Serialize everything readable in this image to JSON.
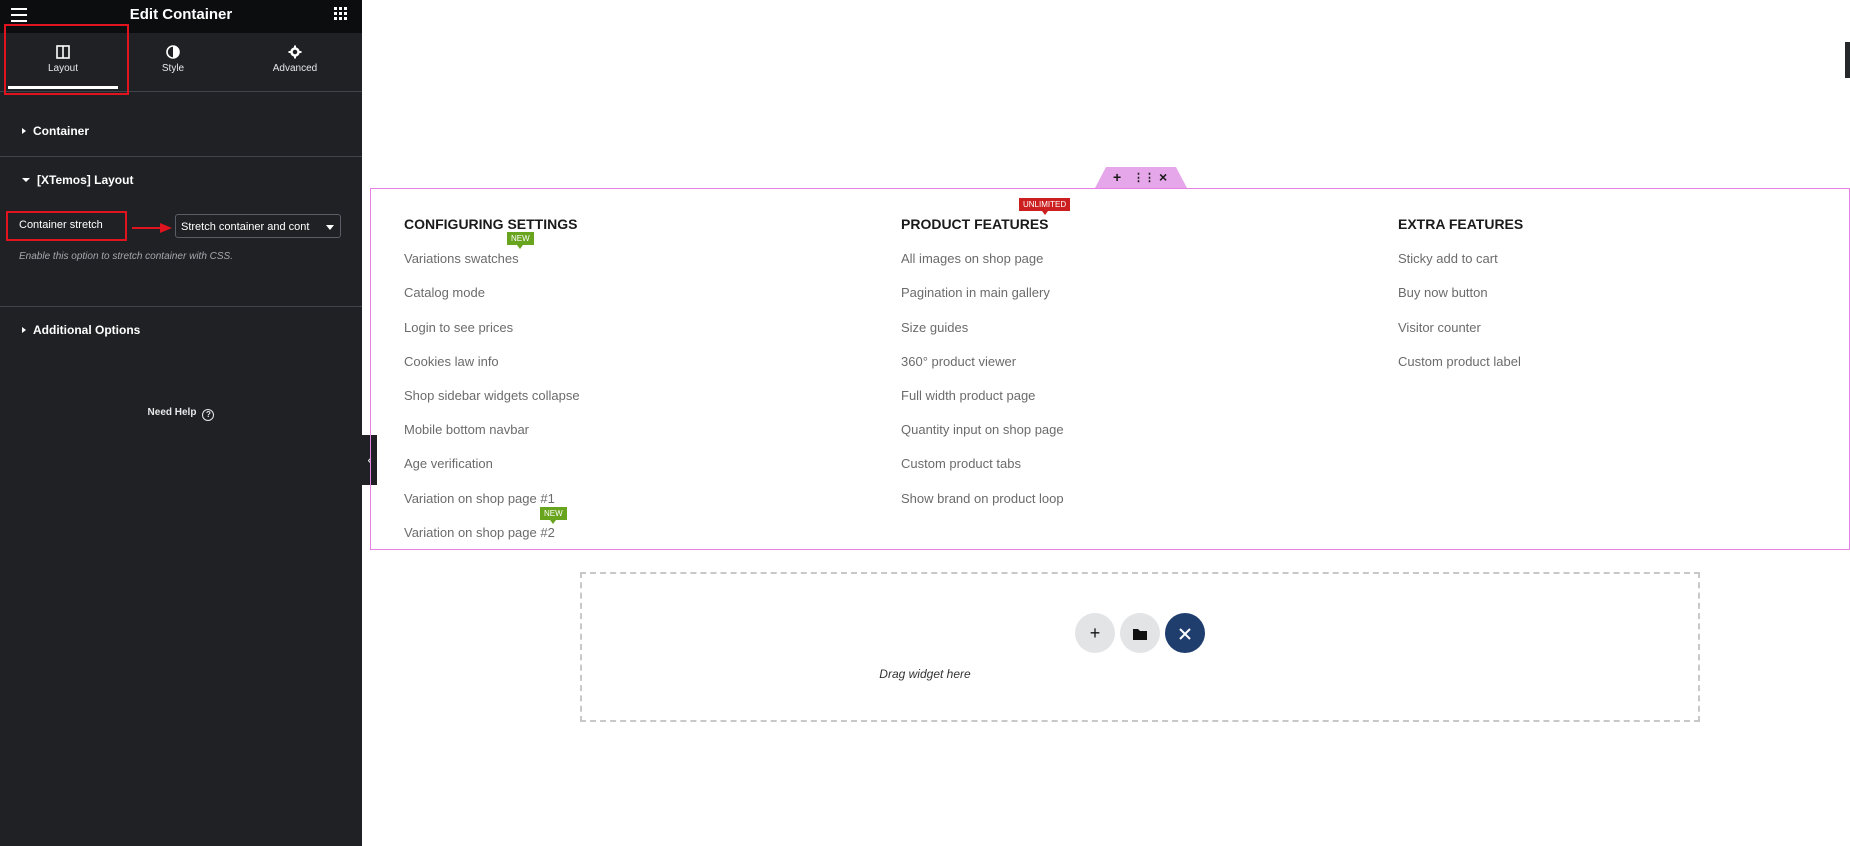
{
  "header": {
    "title": "Edit Container"
  },
  "tabs": [
    {
      "label": "Layout",
      "icon": "layout-columns-icon"
    },
    {
      "label": "Style",
      "icon": "contrast-icon"
    },
    {
      "label": "Advanced",
      "icon": "gear-icon"
    }
  ],
  "sections": {
    "container": "Container",
    "xtemos": "[XTemos] Layout",
    "additional": "Additional Options"
  },
  "control": {
    "label": "Container stretch",
    "value": "Stretch container and cont",
    "hint": "Enable this option to stretch container with CSS."
  },
  "help": {
    "label": "Need Help",
    "icon": "question-icon"
  },
  "columns": [
    {
      "heading": "CONFIGURING SETTINGS",
      "items": [
        "Variations swatches",
        "Catalog mode",
        "Login to see prices",
        "Cookies law info",
        "Shop sidebar widgets collapse",
        "Mobile bottom navbar",
        "Age verification",
        "Variation on shop page #1",
        "Variation on shop page #2"
      ]
    },
    {
      "heading": "PRODUCT FEATURES",
      "items": [
        "All images on shop page",
        "Pagination in main gallery",
        "Size guides",
        "360° product viewer",
        "Full width product page",
        "Quantity input on shop page",
        "Custom product tabs",
        "Show brand on product loop"
      ]
    },
    {
      "heading": "EXTRA FEATURES",
      "items": [
        "Sticky add to cart",
        "Buy now button",
        "Visitor counter",
        "Custom product label"
      ]
    }
  ],
  "badges": {
    "new": "NEW",
    "unlimited": "UNLIMITED"
  },
  "handle": {
    "add": "+",
    "move": "⋮⋮",
    "close": "×"
  },
  "dropzone": {
    "text": "Drag widget here"
  },
  "colors": {
    "accent_red": "#e0141e",
    "badge_new": "#69a41e",
    "badge_unlimited": "#cc1f1f",
    "container_outline": "#e77fe6",
    "dark_button": "#1f3e6e"
  }
}
